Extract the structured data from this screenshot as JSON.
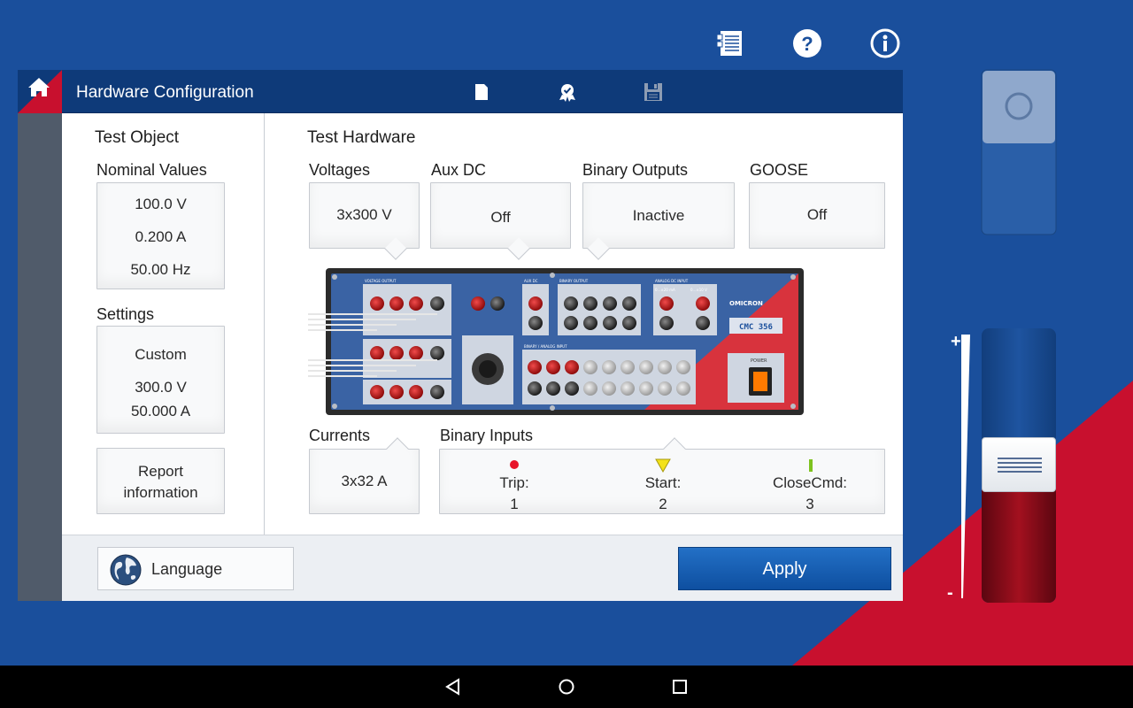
{
  "window": {
    "title": "Hardware Configuration"
  },
  "test_object": {
    "heading": "Test Object",
    "nominal_values": {
      "label": "Nominal Values",
      "voltage": "100.0 V",
      "current": "0.200 A",
      "frequency": "50.00 Hz"
    },
    "settings": {
      "label": "Settings",
      "mode": "Custom",
      "voltage": "300.0 V",
      "current": "50.000 A"
    },
    "report_button": {
      "line1": "Report",
      "line2": "information"
    }
  },
  "test_hardware": {
    "heading": "Test Hardware",
    "voltages": {
      "label": "Voltages",
      "value": "3x300 V"
    },
    "aux_dc": {
      "label": "Aux DC",
      "value": "Off"
    },
    "binary_outputs": {
      "label": "Binary Outputs",
      "value": "Inactive"
    },
    "goose": {
      "label": "GOOSE",
      "value": "Off"
    },
    "currents": {
      "label": "Currents",
      "value": "3x32 A"
    },
    "binary_inputs": {
      "label": "Binary Inputs",
      "items": [
        {
          "name": "Trip:",
          "number": "1",
          "marker": "red-dot",
          "color": "#e8152a"
        },
        {
          "name": "Start:",
          "number": "2",
          "marker": "yellow-triangle",
          "color": "#f3e21a"
        },
        {
          "name": "CloseCmd:",
          "number": "3",
          "marker": "green-bar",
          "color": "#7dc21e"
        }
      ]
    },
    "device": {
      "brand": "OMICRON",
      "model": "CMC 356",
      "voltage_output_label": "VOLTAGE OUTPUT",
      "aux_dc_label": "AUX DC",
      "binary_output_label": "BINARY OUTPUT",
      "analog_dc_input_label": "ANALOG DC INPUT",
      "analog_range_1": "0...±20 mA",
      "analog_range_2": "0...±10 V",
      "binary_analog_input_label": "BINARY / ANALOG INPUT",
      "power_label": "POWER"
    }
  },
  "footer": {
    "language_label": "Language",
    "apply_label": "Apply"
  },
  "colors": {
    "brand_blue": "#1a4f9c",
    "title_blue": "#0e3a79",
    "accent_red": "#c8102e",
    "apply_blue": "#1560b5"
  }
}
